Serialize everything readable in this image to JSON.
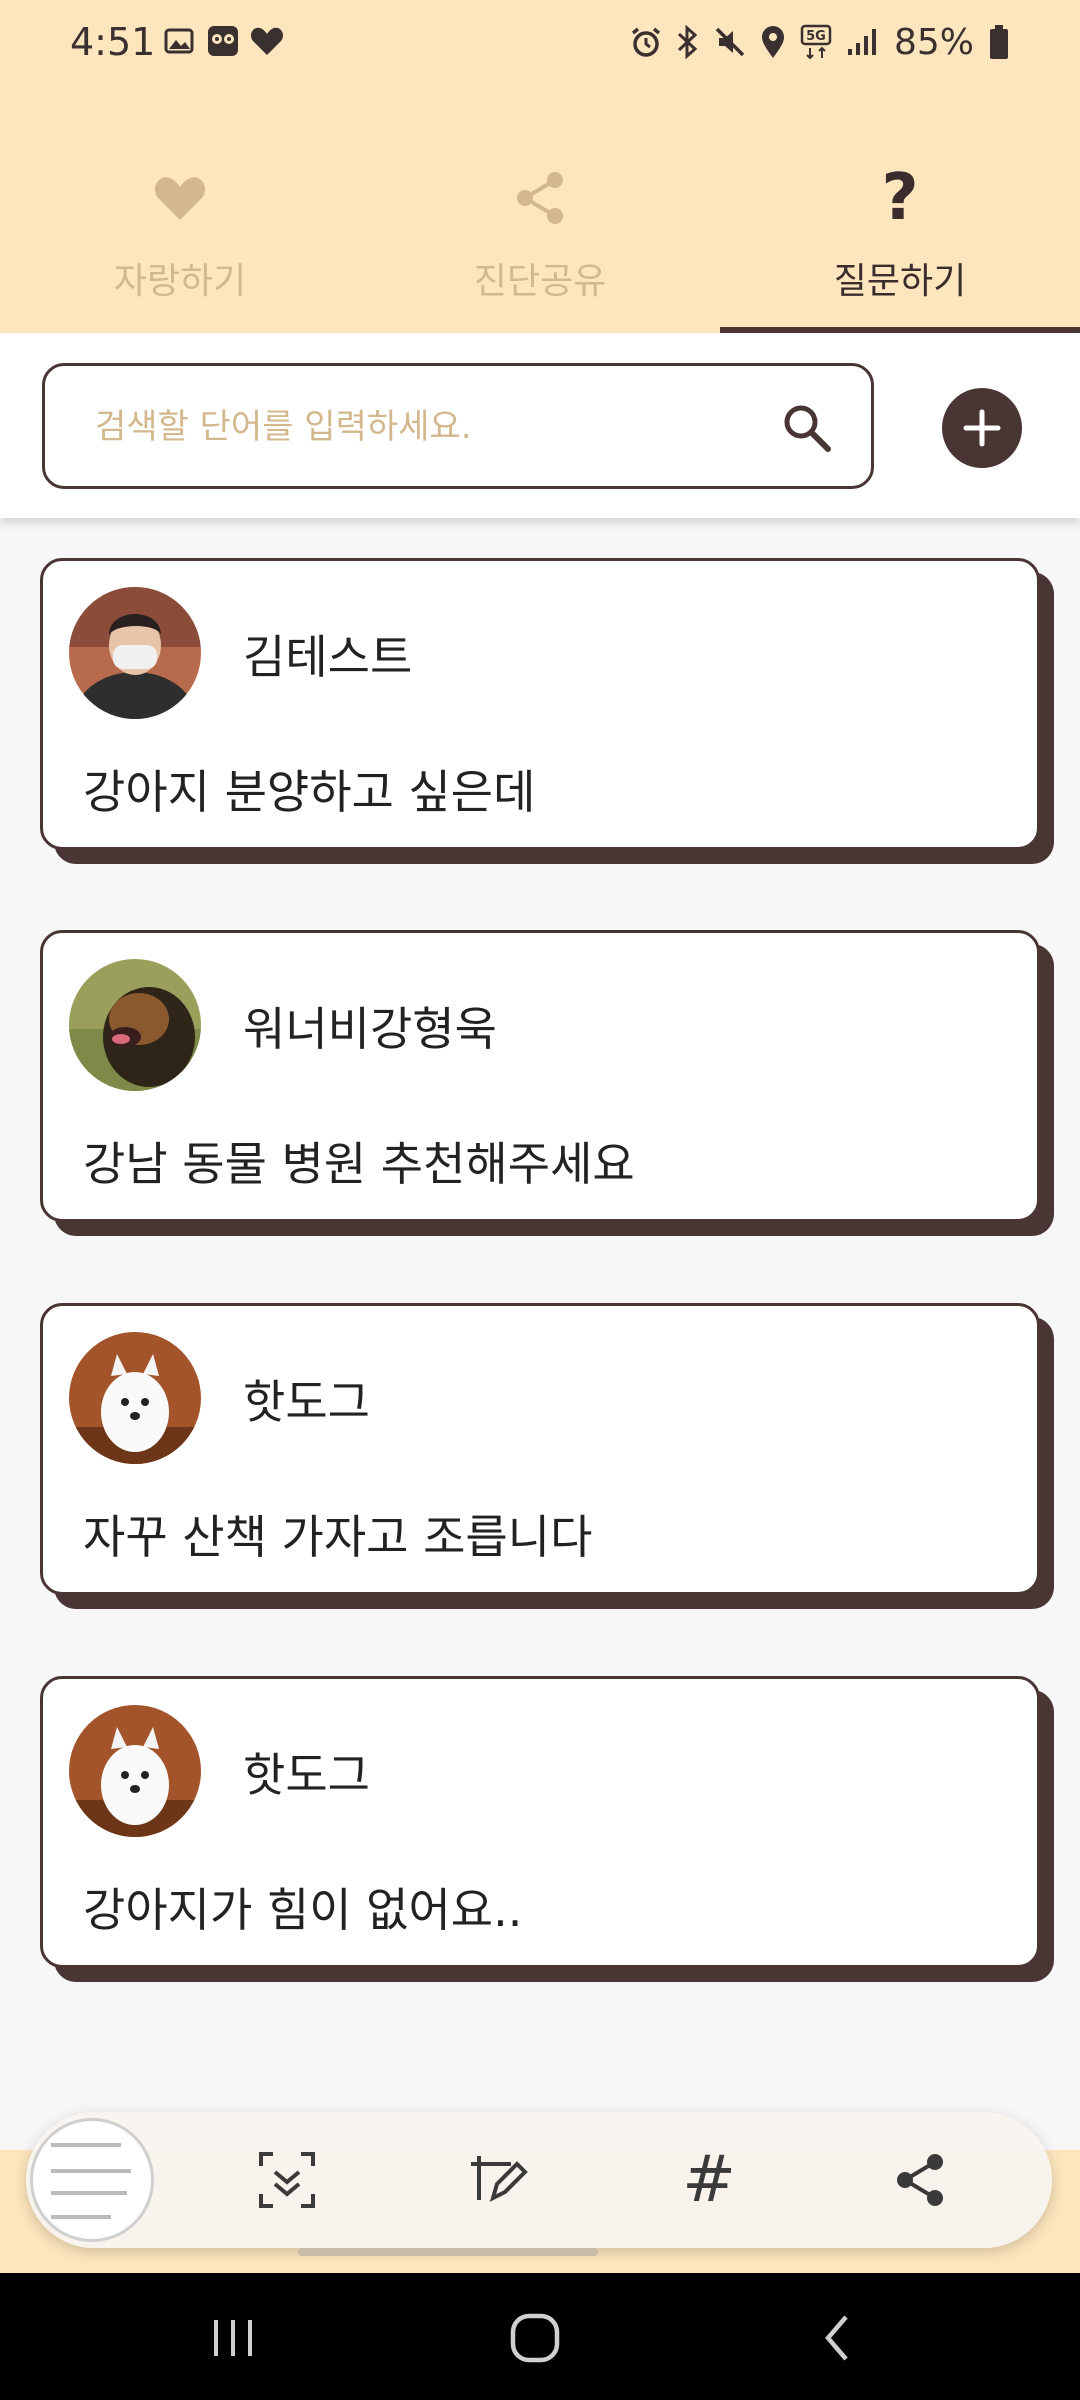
{
  "status_bar": {
    "time": "4:51",
    "left_icons": [
      "image-icon",
      "app-notification-icon",
      "heart-icon"
    ],
    "right_icons": [
      "alarm-icon",
      "bluetooth-icon",
      "mute-icon",
      "location-icon",
      "5g-icon",
      "signal-icon"
    ],
    "battery": "85%"
  },
  "tabs": [
    {
      "label": "자랑하기",
      "icon": "heart-icon",
      "active": false
    },
    {
      "label": "진단공유",
      "icon": "share-icon",
      "active": false
    },
    {
      "label": "질문하기",
      "icon": "question-icon",
      "symbol": "?",
      "active": true
    }
  ],
  "search": {
    "placeholder": "검색할 단어를 입력하세요.",
    "value": ""
  },
  "posts": [
    {
      "name": "김테스트",
      "text": "강아지 분양하고 싶은데",
      "avatar": "person-avatar"
    },
    {
      "name": "워너비강형욱",
      "text": "강남 동물 병원 추천해주세요",
      "avatar": "dog-avatar"
    },
    {
      "name": "핫도그",
      "text": "자꾸 산책 가자고 조릅니다",
      "avatar": "dog-avatar"
    },
    {
      "name": "핫도그",
      "text": "강아지가 힘이 없어요..",
      "avatar": "dog-avatar"
    }
  ],
  "toolbar": {
    "items": [
      "screenshot-thumbnail",
      "scroll-capture-icon",
      "edit-icon",
      "tag-icon",
      "share-icon"
    ],
    "hash_symbol": "#"
  },
  "colors": {
    "header_bg": "#fde6bd",
    "accent_dark": "#4a3535",
    "inactive_tab": "#d3b88e"
  }
}
